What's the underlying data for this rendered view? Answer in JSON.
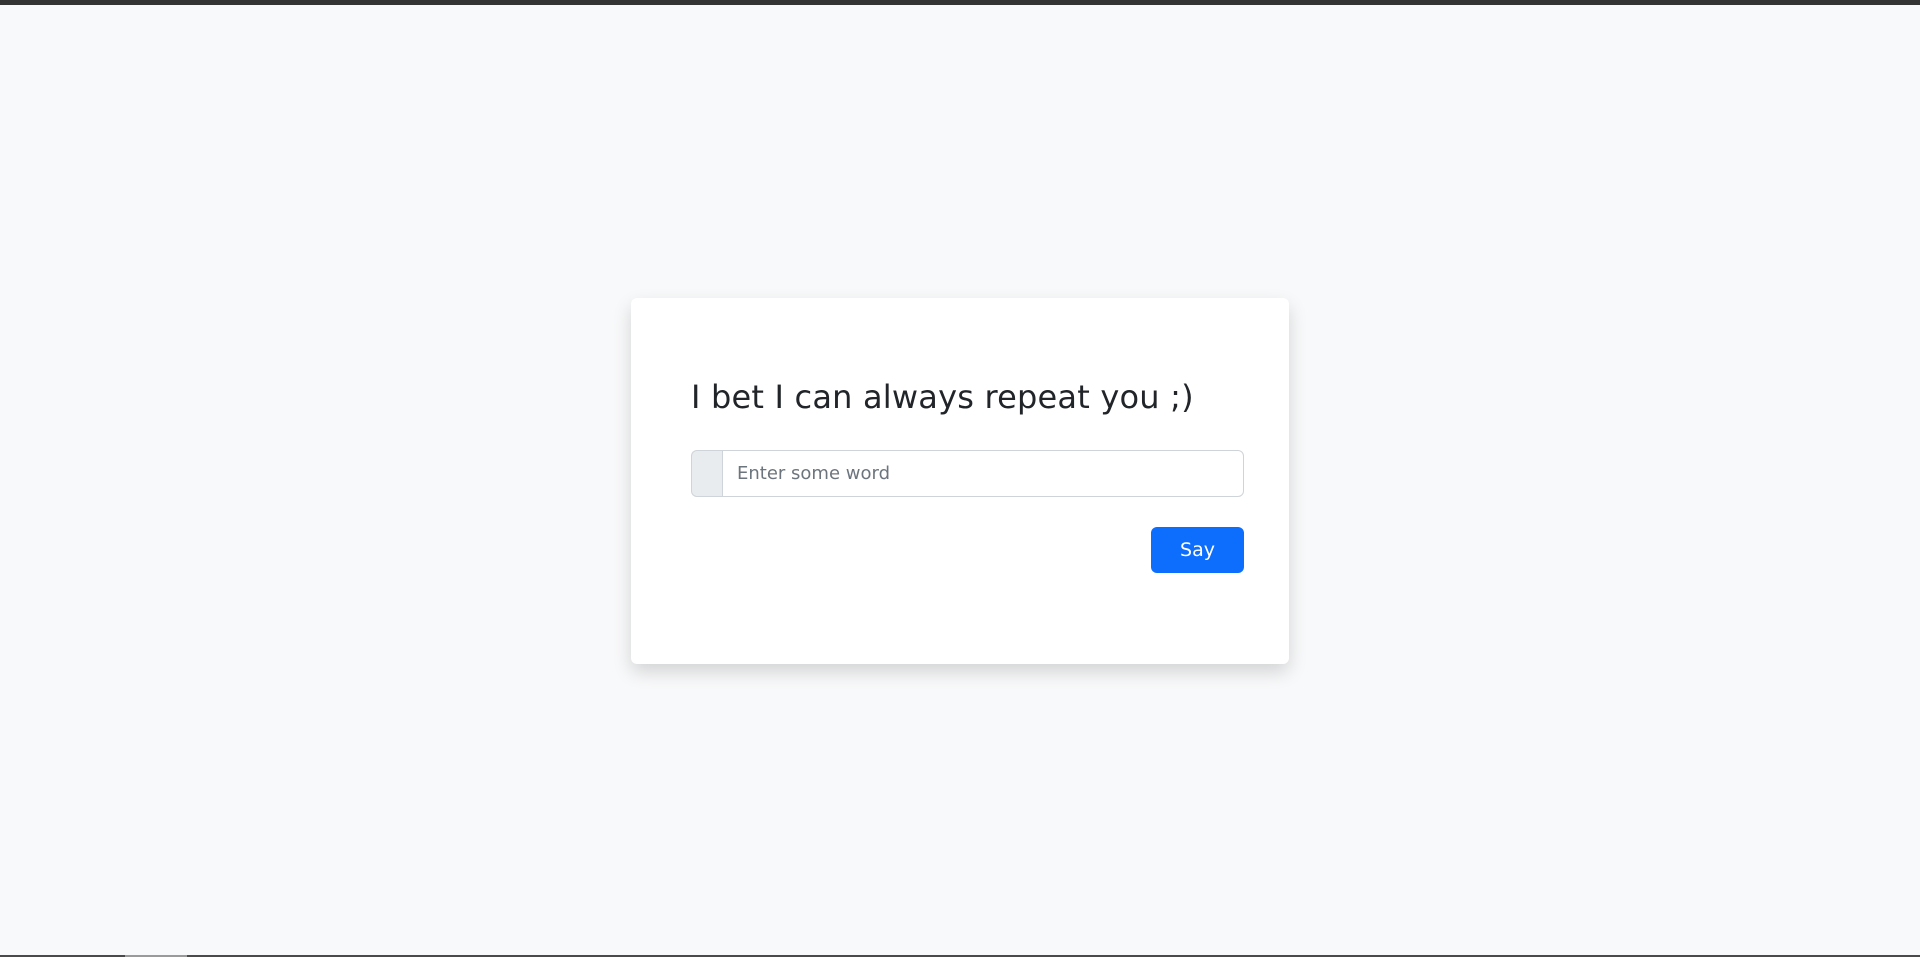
{
  "page": {
    "background": "#f8f9fa"
  },
  "card": {
    "title": "I bet I can always repeat you ;)",
    "input": {
      "value": "",
      "placeholder": "Enter some word"
    },
    "submit_label": "Say"
  },
  "colors": {
    "accent": "#0d6efd",
    "text": "#212529",
    "placeholder": "#6c757d",
    "prefix_bg": "#e9ecef"
  }
}
